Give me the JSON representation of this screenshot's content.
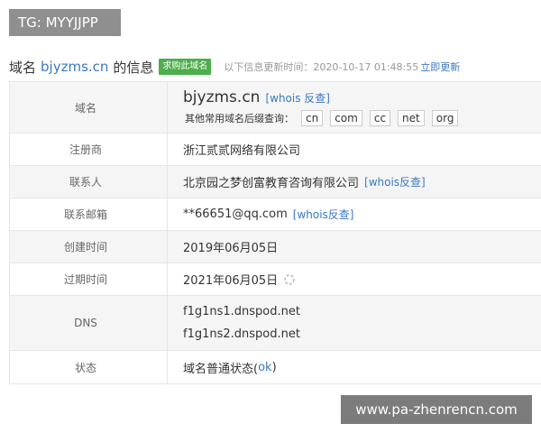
{
  "banner": {
    "text": "TG: MYYJJPP"
  },
  "heading": {
    "prefix": "域名",
    "domain": "bjyzms.cn",
    "suffix": "的信息",
    "buy_button": "求购此域名",
    "updated_prefix": "以下信息更新时间：2020-10-17 01:48:55",
    "update_link": "立即更新"
  },
  "rows": {
    "domain": {
      "label": "域名",
      "value": "bjyzms.cn",
      "whois_link": "[whois 反查]",
      "suffix_label": "其他常用域名后缀查询：",
      "suffixes": [
        "cn",
        "com",
        "cc",
        "net",
        "org"
      ]
    },
    "registrar": {
      "label": "注册商",
      "value": "浙江贰贰网络有限公司"
    },
    "contact": {
      "label": "联系人",
      "value": "北京园之梦创富教育咨询有限公司",
      "whois_link": "[whois反查]"
    },
    "email": {
      "label": "联系邮箱",
      "value": "**66651@qq.com",
      "whois_link": "[whois反查]"
    },
    "created": {
      "label": "创建时间",
      "value": "2019年06月05日"
    },
    "expires": {
      "label": "过期时间",
      "value": "2021年06月05日",
      "icon": "refresh-icon"
    },
    "dns": {
      "label": "DNS",
      "servers": [
        "f1g1ns1.dnspod.net",
        "f1g1ns2.dnspod.net"
      ]
    },
    "status": {
      "label": "状态",
      "prefix": "域名普通状态(",
      "link": "ok",
      "suffix": ")"
    }
  },
  "watermark": {
    "text": "www.pa-zhenrencn.com"
  },
  "colors": {
    "link": "#3a78c3",
    "buy_button": "#4cae4c",
    "row_alt": "#f5f5f5"
  }
}
